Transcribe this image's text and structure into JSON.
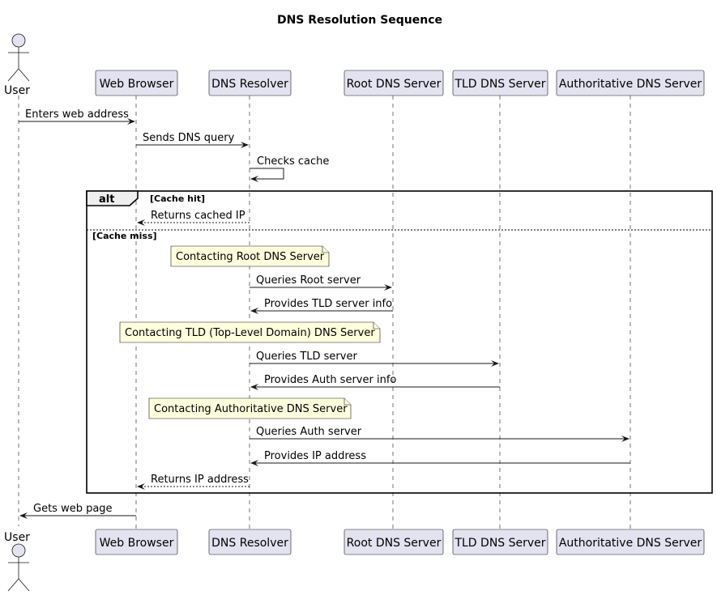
{
  "title": "DNS Resolution Sequence",
  "participants": [
    {
      "id": "user",
      "label": "User",
      "kind": "actor"
    },
    {
      "id": "browser",
      "label": "Web Browser",
      "kind": "box"
    },
    {
      "id": "resolver",
      "label": "DNS Resolver",
      "kind": "box"
    },
    {
      "id": "root",
      "label": "Root DNS Server",
      "kind": "box"
    },
    {
      "id": "tld",
      "label": "TLD DNS Server",
      "kind": "box"
    },
    {
      "id": "auth",
      "label": "Authoritative DNS Server",
      "kind": "box"
    }
  ],
  "messages": [
    {
      "from": "user",
      "to": "browser",
      "label": "Enters web address",
      "style": "solid"
    },
    {
      "from": "browser",
      "to": "resolver",
      "label": "Sends DNS query",
      "style": "solid"
    },
    {
      "from": "resolver",
      "to": "resolver",
      "label": "Checks cache",
      "style": "solid"
    },
    {
      "from": "resolver",
      "to": "browser",
      "label": "Returns cached IP",
      "style": "dashed"
    },
    {
      "from": "resolver",
      "to": "root",
      "label": "Queries Root server",
      "style": "solid"
    },
    {
      "from": "root",
      "to": "resolver",
      "label": "Provides TLD server info",
      "style": "solid"
    },
    {
      "from": "resolver",
      "to": "tld",
      "label": "Queries TLD server",
      "style": "solid"
    },
    {
      "from": "tld",
      "to": "resolver",
      "label": "Provides Auth server info",
      "style": "solid"
    },
    {
      "from": "resolver",
      "to": "auth",
      "label": "Queries Auth server",
      "style": "solid"
    },
    {
      "from": "auth",
      "to": "resolver",
      "label": "Provides IP address",
      "style": "solid"
    },
    {
      "from": "resolver",
      "to": "browser",
      "label": "Returns IP address",
      "style": "dashed"
    },
    {
      "from": "browser",
      "to": "user",
      "label": "Gets web page",
      "style": "solid"
    }
  ],
  "notes": [
    {
      "text": "Contacting Root DNS Server"
    },
    {
      "text": "Contacting TLD (Top-Level Domain) DNS Server"
    },
    {
      "text": "Contacting Authoritative DNS Server"
    }
  ],
  "fragment": {
    "label": "alt",
    "guards": [
      "[Cache hit]",
      "[Cache miss]"
    ]
  }
}
